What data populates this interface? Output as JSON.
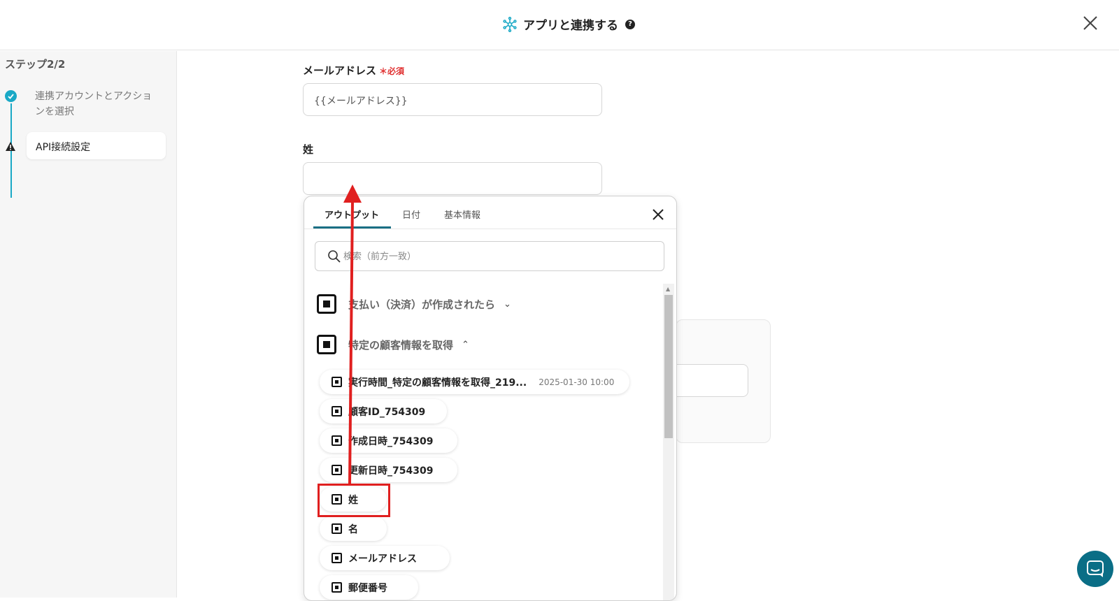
{
  "header": {
    "title": "アプリと連携する",
    "help_icon": "?"
  },
  "sidebar": {
    "step_count": "ステップ2/2",
    "steps": [
      {
        "label": "連携アカウントとアクションを選択",
        "status": "done"
      },
      {
        "label": "API接続設定",
        "status": "warning"
      }
    ]
  },
  "form": {
    "email": {
      "label": "メールアドレス",
      "required_mark": "＊必須",
      "value": "{{メールアドレス}}"
    },
    "last_name": {
      "label": "姓",
      "value": ""
    }
  },
  "popup": {
    "tabs": [
      "アウトプット",
      "日付",
      "基本情報"
    ],
    "active_tab": "アウトプット",
    "search_placeholder": "検索（前方一致）",
    "groups": [
      {
        "label": "支払い（決済）が作成されたら",
        "expanded": false
      },
      {
        "label": "特定の顧客情報を取得",
        "expanded": true
      }
    ],
    "items": [
      {
        "label": "実行時間_特定の顧客情報を取得_219...",
        "date": "2025-01-30 10:00"
      },
      {
        "label": "顧客ID_754309"
      },
      {
        "label": "作成日時_754309"
      },
      {
        "label": "更新日時_754309"
      },
      {
        "label": "姓"
      },
      {
        "label": "名"
      },
      {
        "label": "メールアドレス"
      },
      {
        "label": "郵便番号"
      }
    ]
  },
  "colors": {
    "accent": "#1aa9c6",
    "annotation": "#e01f1f",
    "chat": "#0a6e86"
  }
}
